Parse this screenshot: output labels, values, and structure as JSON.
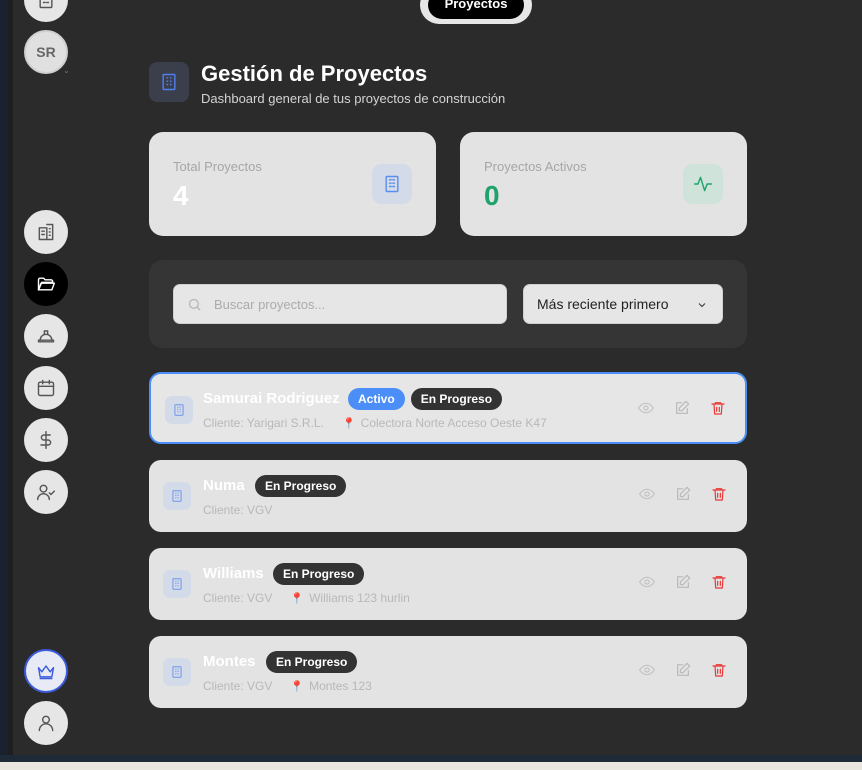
{
  "top_tab": {
    "label": "Proyectos"
  },
  "user": {
    "initials": "SR"
  },
  "header": {
    "title": "Gestión de Proyectos",
    "subtitle": "Dashboard general de tus proyectos de construcción"
  },
  "stats": [
    {
      "label": "Total Proyectos",
      "value": "4",
      "color": "#ffffff",
      "icon": "building-icon"
    },
    {
      "label": "Proyectos Activos",
      "value": "0",
      "color": "#1fa36a",
      "icon": "activity-icon"
    }
  ],
  "filters": {
    "search_placeholder": "Buscar proyectos...",
    "sort_value": "Más reciente primero"
  },
  "projects": [
    {
      "name": "Samurai Rodriguez",
      "badges": [
        "Activo",
        "En Progreso"
      ],
      "client": "Cliente: Yarigari S.R.L.",
      "location": "Colectora Norte Acceso Oeste K47",
      "selected": true
    },
    {
      "name": "Numa",
      "badges": [
        "En Progreso"
      ],
      "client": "Cliente: VGV",
      "location": ""
    },
    {
      "name": "Williams",
      "badges": [
        "En Progreso"
      ],
      "client": "Cliente: VGV",
      "location": "Williams 123 hurlin"
    },
    {
      "name": "Montes",
      "badges": [
        "En Progreso"
      ],
      "client": "Cliente: VGV",
      "location": "Montes 123"
    }
  ],
  "colors": {
    "accent": "#4c8ef7",
    "danger": "#e53935",
    "active_green": "#1fa36a"
  }
}
